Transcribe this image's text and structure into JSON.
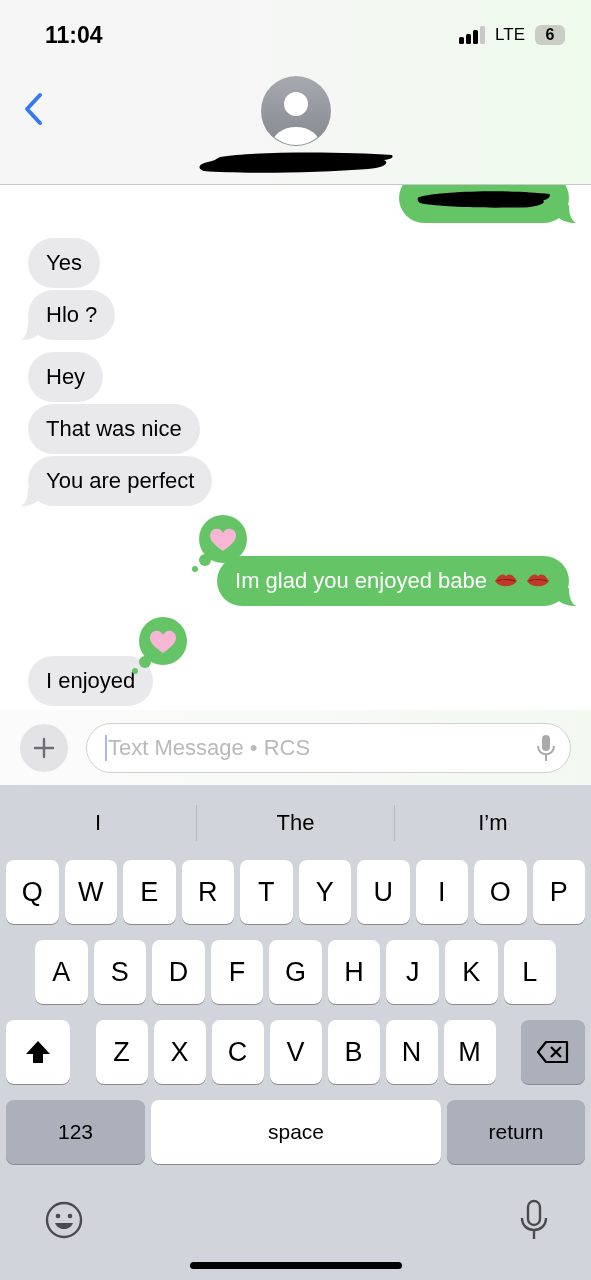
{
  "status_bar": {
    "time": "11:04",
    "network": "LTE",
    "battery": "6"
  },
  "header": {
    "contact_redacted": true
  },
  "conversation": [
    {
      "kind": "sent",
      "bubbles": [
        {
          "redacted": true,
          "tail": true
        }
      ]
    },
    {
      "kind": "received",
      "bubbles": [
        {
          "text": "Yes",
          "tail": false
        },
        {
          "text": "Hlo ?",
          "tail": true
        }
      ]
    },
    {
      "kind": "received",
      "bubbles": [
        {
          "text": "Hey",
          "tail": false
        },
        {
          "text": "That was nice",
          "tail": false
        },
        {
          "text": "You are perfect",
          "tail": true
        }
      ]
    },
    {
      "kind": "sent",
      "bubbles": [
        {
          "text": "Im glad you enjoyed babe",
          "emoji": [
            {
              "kind": "lips"
            },
            {
              "kind": "lips"
            }
          ],
          "tail": true,
          "reacted": true
        }
      ]
    },
    {
      "kind": "received",
      "bubbles": [
        {
          "text": "I enjoyed",
          "tail": false,
          "reacted": true
        }
      ]
    }
  ],
  "composer": {
    "placeholder": "Text Message • RCS"
  },
  "suggestions": [
    "I",
    "The",
    "I’m"
  ],
  "keyboard": {
    "letter_rows": [
      {
        "keys": [
          "Q",
          "W",
          "E",
          "R",
          "T",
          "Y",
          "U",
          "I",
          "O",
          "P"
        ]
      },
      {
        "keys": [
          "A",
          "S",
          "D",
          "F",
          "G",
          "H",
          "J",
          "K",
          "L"
        ]
      },
      {
        "keys": [
          "Z",
          "X",
          "C",
          "V",
          "B",
          "N",
          "M"
        ]
      }
    ],
    "numbers_key": "123",
    "space_key": "space",
    "return_key": "return"
  }
}
